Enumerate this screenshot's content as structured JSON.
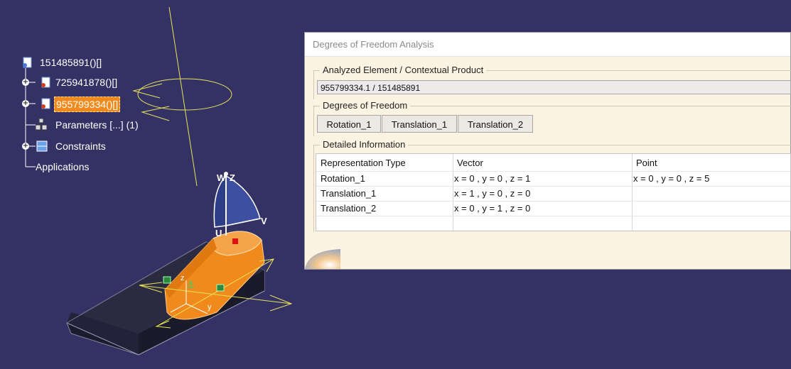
{
  "tree": {
    "root_label": "151485891()[]",
    "child1_label": "725941878()[]",
    "child2_label": "955799334()[]",
    "parameters_label": "Parameters [...] (1)",
    "constraints_label": "Constraints",
    "applications_label": "Applications"
  },
  "compass": {
    "w": "W",
    "z": "Z",
    "u": "U",
    "v": "V"
  },
  "part_axes": {
    "z": "z",
    "y": "y"
  },
  "dialog": {
    "title": "Degrees of Freedom Analysis",
    "analyzed": {
      "legend": "Analyzed Element / Contextual Product",
      "value": "955799334.1 / 151485891"
    },
    "dof": {
      "legend": "Degrees of Freedom",
      "buttons": [
        "Rotation_1",
        "Translation_1",
        "Translation_2"
      ]
    },
    "detail": {
      "legend": "Detailed Information",
      "headers": [
        "Representation Type",
        "Vector",
        "Point"
      ],
      "rows": [
        [
          "Rotation_1",
          "x = 0 ,  y = 0 ,  z = 1",
          "x = 0 ,  y = 0 ,  z = 5"
        ],
        [
          "Translation_1",
          "x = 1 ,  y = 0 ,  z = 0",
          ""
        ],
        [
          "Translation_2",
          "x = 0 ,  y = 1 ,  z = 0",
          ""
        ]
      ]
    }
  },
  "colors": {
    "background": "#343265",
    "part_orange": "#f08a1c",
    "axis_yellow": "#e8e35a",
    "dialog_bg": "#fdf3e3",
    "selection": "#f08a1c"
  }
}
